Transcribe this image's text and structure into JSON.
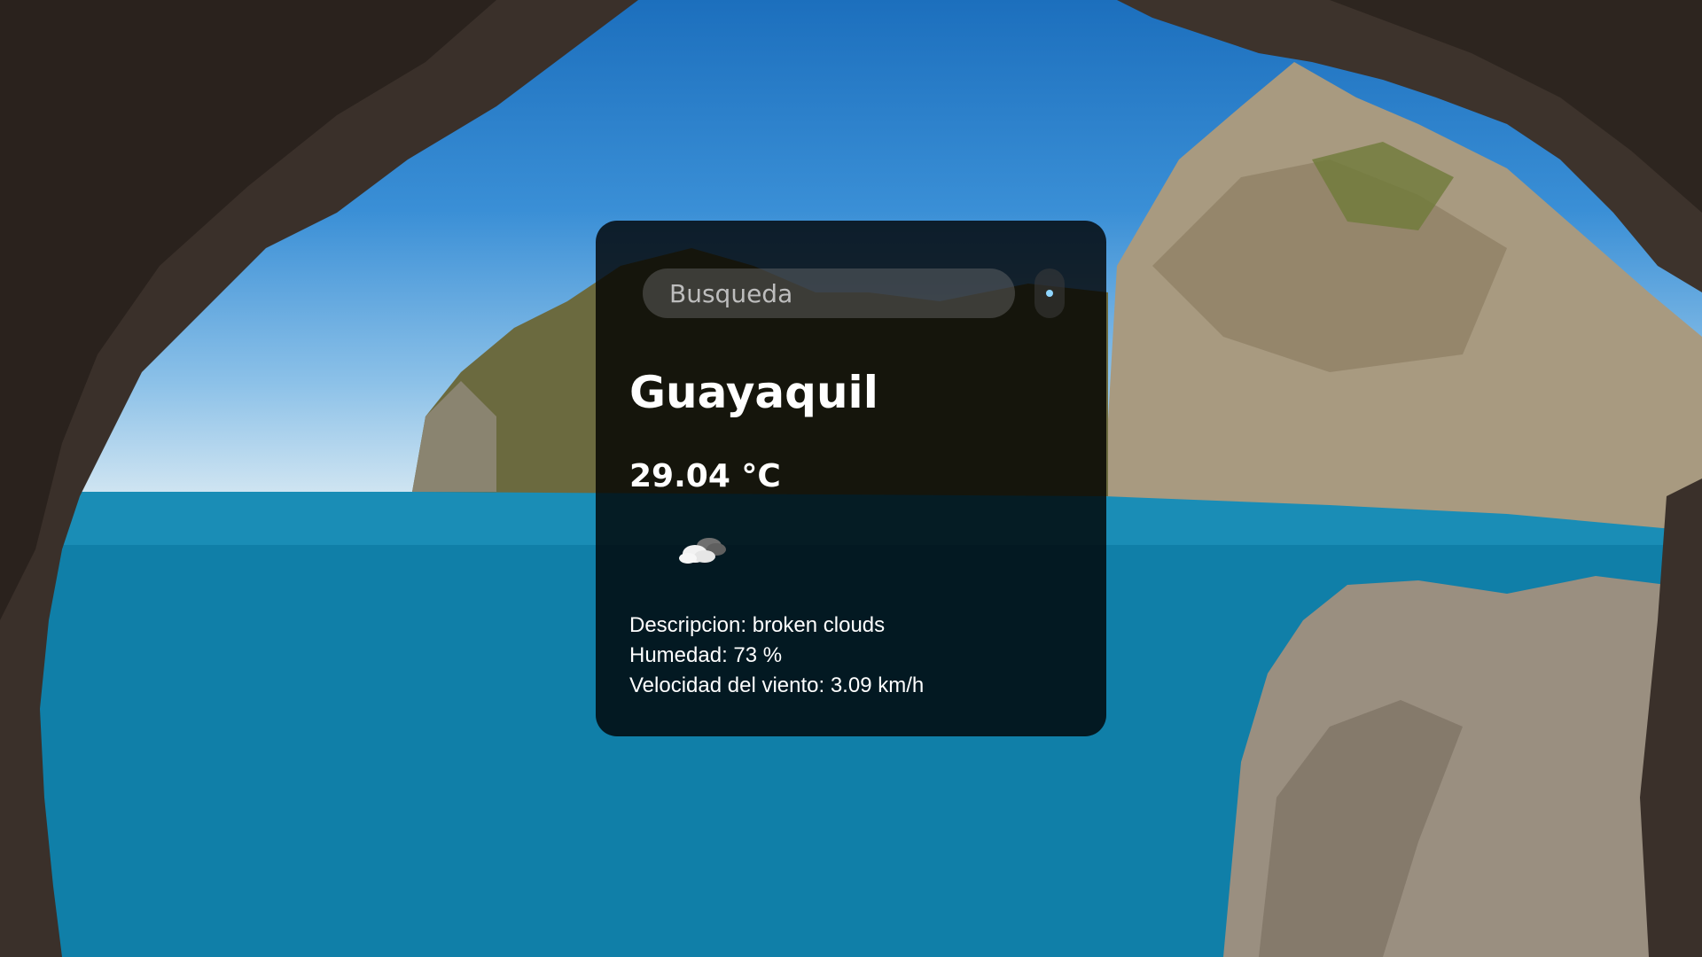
{
  "search": {
    "placeholder": "Busqueda"
  },
  "weather": {
    "city": "Guayaquil",
    "temperature": "29.04 °C",
    "icon": "broken-clouds-icon",
    "description_line": "Descripcion: broken clouds",
    "humidity_line": "Humedad: 73 %",
    "wind_line": "Velocidad del viento: 3.09 km/h"
  },
  "colors": {
    "card_background": "#000000cc",
    "text": "#ffffff",
    "search_field": "#787878"
  },
  "background_image": "coastal-cave-arch-sea-cliffs"
}
